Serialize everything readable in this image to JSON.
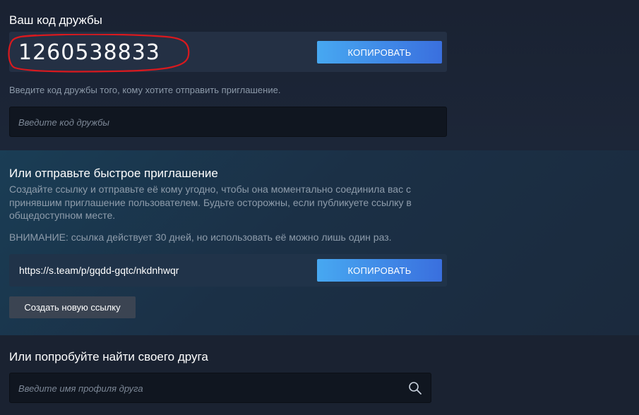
{
  "friend_code_section": {
    "title": "Ваш код дружбы",
    "code": "1260538833",
    "copy_label": "КОПИРОВАТЬ",
    "hint": "Введите код дружбы того, кому хотите отправить приглашение.",
    "input_placeholder": "Введите код дружбы"
  },
  "quick_invite_section": {
    "title": "Или отправьте быстрое приглашение",
    "description": "Создайте ссылку и отправьте её кому угодно, чтобы она моментально соединила вас с принявшим приглашение пользователем. Будьте осторожны, если публикуете ссылку в общедоступном месте.",
    "warning": "ВНИМАНИЕ: ссылка действует 30 дней, но использовать её можно лишь один раз.",
    "link": "https://s.team/p/gqdd-gqtc/nkdnhwqr",
    "copy_label": "КОПИРОВАТЬ",
    "new_link_label": "Создать новую ссылку"
  },
  "search_section": {
    "title": "Или попробуйте найти своего друга",
    "input_placeholder": "Введите имя профиля друга",
    "search_icon": "search-icon"
  },
  "colors": {
    "accent_gradient_start": "#47a8f1",
    "accent_gradient_end": "#3a6fde",
    "highlight_circle": "#d9191e"
  }
}
